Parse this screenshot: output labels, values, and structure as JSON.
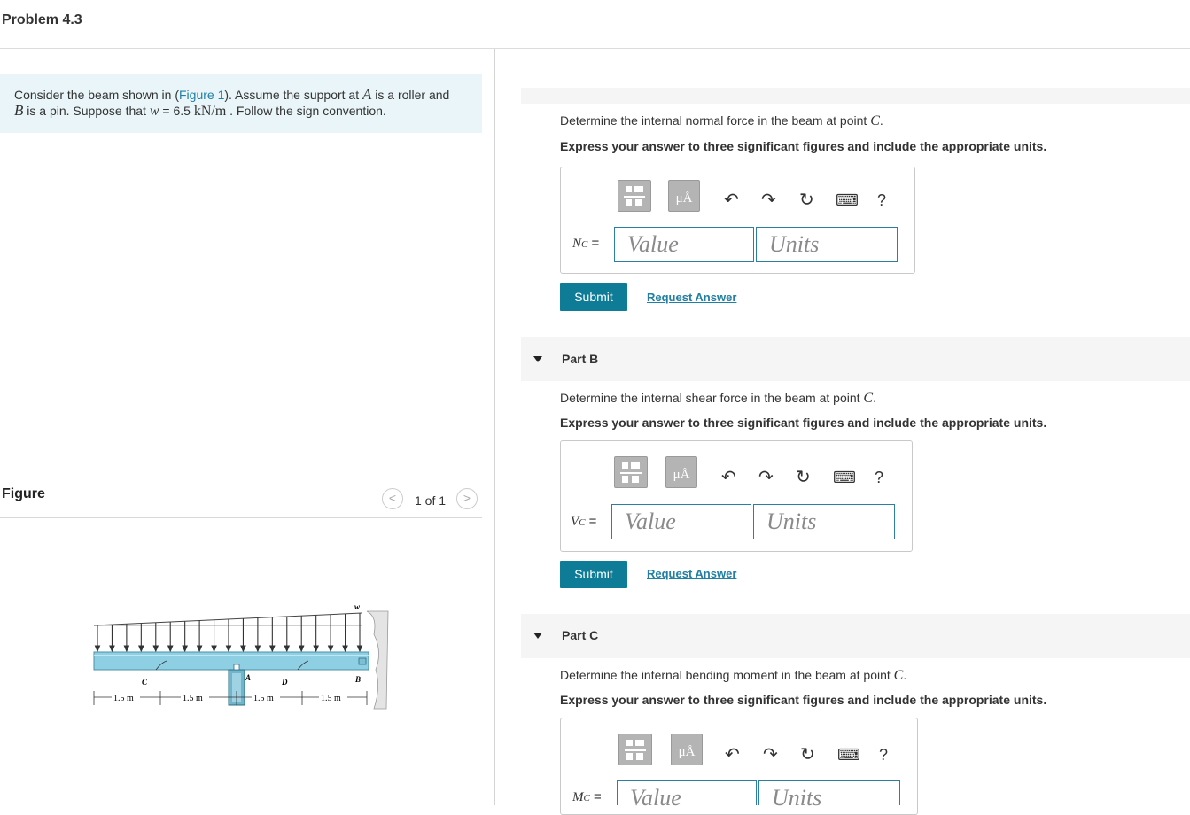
{
  "header": {
    "title": "Problem 4.3"
  },
  "problem": {
    "line1_before": "Consider the beam shown in (",
    "figure_link": "Figure 1",
    "line1_after": "). Assume the support at ",
    "point_A": "A",
    "line1_end": " is a roller and",
    "point_B": "B",
    "line2_text": " is a pin. Suppose that ",
    "w_symbol": "w",
    "w_value": " = 6.5 ",
    "w_units": "kN/m",
    "line2_end": " . Follow the sign convention."
  },
  "figure": {
    "label": "Figure",
    "pager": {
      "count": "1 of 1",
      "prev": "<",
      "next": ">"
    },
    "diagram": {
      "load_label": "w",
      "points": [
        "C",
        "A",
        "D",
        "B"
      ],
      "dimensions": [
        "1.5 m",
        "1.5 m",
        "1.5 m",
        "1.5 m"
      ]
    }
  },
  "toolbar": {
    "units_button": "μÅ",
    "undo_icon": "↶",
    "redo_icon": "↷",
    "reset_icon": "↻",
    "keyboard_icon": "⌨",
    "help_label": "?"
  },
  "parts": [
    {
      "id": "A",
      "question_prefix": "Determine the internal normal force in the beam at point ",
      "point": "C",
      "question_suffix": ".",
      "instruction": "Express your answer to three significant figures and include the appropriate units.",
      "var_main": "N",
      "var_sub": "C",
      "equals": " =",
      "value_placeholder": "Value",
      "units_placeholder": "Units",
      "submit_label": "Submit",
      "request_label": "Request Answer"
    },
    {
      "id": "B",
      "title": "Part B",
      "question_prefix": "Determine the internal shear force in the beam at point ",
      "point": "C",
      "question_suffix": ".",
      "instruction": "Express your answer to three significant figures and include the appropriate units.",
      "var_main": "V",
      "var_sub": "C",
      "equals": " =",
      "value_placeholder": "Value",
      "units_placeholder": "Units",
      "submit_label": "Submit",
      "request_label": "Request Answer"
    },
    {
      "id": "C",
      "title": "Part C",
      "question_prefix": "Determine the internal bending moment in the beam at point ",
      "point": "C",
      "question_suffix": ".",
      "instruction": "Express your answer to three significant figures and include the appropriate units.",
      "var_main": "M",
      "var_sub": "C",
      "equals": " =",
      "value_placeholder": "Value",
      "units_placeholder": "Units"
    }
  ]
}
